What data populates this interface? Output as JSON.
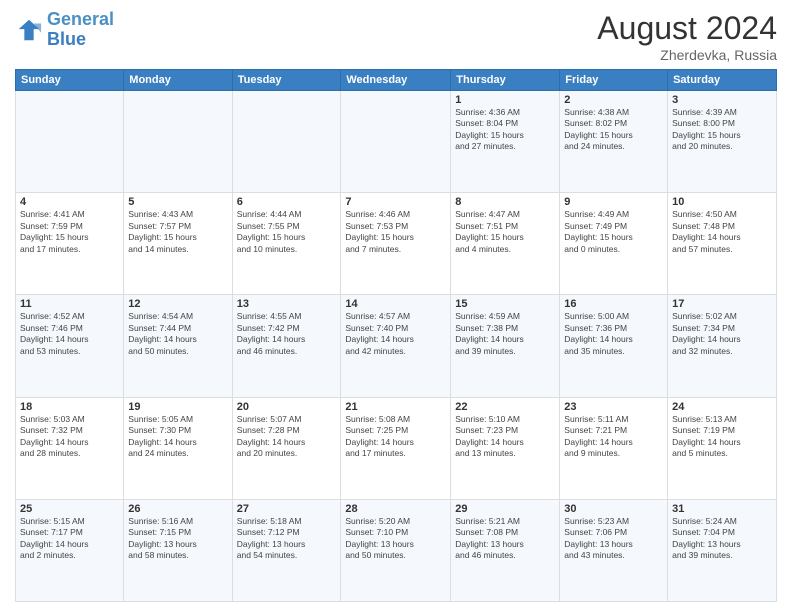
{
  "logo": {
    "line1": "General",
    "line2": "Blue"
  },
  "header": {
    "month_year": "August 2024",
    "location": "Zherdevka, Russia"
  },
  "weekdays": [
    "Sunday",
    "Monday",
    "Tuesday",
    "Wednesday",
    "Thursday",
    "Friday",
    "Saturday"
  ],
  "weeks": [
    [
      {
        "day": "",
        "info": ""
      },
      {
        "day": "",
        "info": ""
      },
      {
        "day": "",
        "info": ""
      },
      {
        "day": "",
        "info": ""
      },
      {
        "day": "1",
        "info": "Sunrise: 4:36 AM\nSunset: 8:04 PM\nDaylight: 15 hours\nand 27 minutes."
      },
      {
        "day": "2",
        "info": "Sunrise: 4:38 AM\nSunset: 8:02 PM\nDaylight: 15 hours\nand 24 minutes."
      },
      {
        "day": "3",
        "info": "Sunrise: 4:39 AM\nSunset: 8:00 PM\nDaylight: 15 hours\nand 20 minutes."
      }
    ],
    [
      {
        "day": "4",
        "info": "Sunrise: 4:41 AM\nSunset: 7:59 PM\nDaylight: 15 hours\nand 17 minutes."
      },
      {
        "day": "5",
        "info": "Sunrise: 4:43 AM\nSunset: 7:57 PM\nDaylight: 15 hours\nand 14 minutes."
      },
      {
        "day": "6",
        "info": "Sunrise: 4:44 AM\nSunset: 7:55 PM\nDaylight: 15 hours\nand 10 minutes."
      },
      {
        "day": "7",
        "info": "Sunrise: 4:46 AM\nSunset: 7:53 PM\nDaylight: 15 hours\nand 7 minutes."
      },
      {
        "day": "8",
        "info": "Sunrise: 4:47 AM\nSunset: 7:51 PM\nDaylight: 15 hours\nand 4 minutes."
      },
      {
        "day": "9",
        "info": "Sunrise: 4:49 AM\nSunset: 7:49 PM\nDaylight: 15 hours\nand 0 minutes."
      },
      {
        "day": "10",
        "info": "Sunrise: 4:50 AM\nSunset: 7:48 PM\nDaylight: 14 hours\nand 57 minutes."
      }
    ],
    [
      {
        "day": "11",
        "info": "Sunrise: 4:52 AM\nSunset: 7:46 PM\nDaylight: 14 hours\nand 53 minutes."
      },
      {
        "day": "12",
        "info": "Sunrise: 4:54 AM\nSunset: 7:44 PM\nDaylight: 14 hours\nand 50 minutes."
      },
      {
        "day": "13",
        "info": "Sunrise: 4:55 AM\nSunset: 7:42 PM\nDaylight: 14 hours\nand 46 minutes."
      },
      {
        "day": "14",
        "info": "Sunrise: 4:57 AM\nSunset: 7:40 PM\nDaylight: 14 hours\nand 42 minutes."
      },
      {
        "day": "15",
        "info": "Sunrise: 4:59 AM\nSunset: 7:38 PM\nDaylight: 14 hours\nand 39 minutes."
      },
      {
        "day": "16",
        "info": "Sunrise: 5:00 AM\nSunset: 7:36 PM\nDaylight: 14 hours\nand 35 minutes."
      },
      {
        "day": "17",
        "info": "Sunrise: 5:02 AM\nSunset: 7:34 PM\nDaylight: 14 hours\nand 32 minutes."
      }
    ],
    [
      {
        "day": "18",
        "info": "Sunrise: 5:03 AM\nSunset: 7:32 PM\nDaylight: 14 hours\nand 28 minutes."
      },
      {
        "day": "19",
        "info": "Sunrise: 5:05 AM\nSunset: 7:30 PM\nDaylight: 14 hours\nand 24 minutes."
      },
      {
        "day": "20",
        "info": "Sunrise: 5:07 AM\nSunset: 7:28 PM\nDaylight: 14 hours\nand 20 minutes."
      },
      {
        "day": "21",
        "info": "Sunrise: 5:08 AM\nSunset: 7:25 PM\nDaylight: 14 hours\nand 17 minutes."
      },
      {
        "day": "22",
        "info": "Sunrise: 5:10 AM\nSunset: 7:23 PM\nDaylight: 14 hours\nand 13 minutes."
      },
      {
        "day": "23",
        "info": "Sunrise: 5:11 AM\nSunset: 7:21 PM\nDaylight: 14 hours\nand 9 minutes."
      },
      {
        "day": "24",
        "info": "Sunrise: 5:13 AM\nSunset: 7:19 PM\nDaylight: 14 hours\nand 5 minutes."
      }
    ],
    [
      {
        "day": "25",
        "info": "Sunrise: 5:15 AM\nSunset: 7:17 PM\nDaylight: 14 hours\nand 2 minutes."
      },
      {
        "day": "26",
        "info": "Sunrise: 5:16 AM\nSunset: 7:15 PM\nDaylight: 13 hours\nand 58 minutes."
      },
      {
        "day": "27",
        "info": "Sunrise: 5:18 AM\nSunset: 7:12 PM\nDaylight: 13 hours\nand 54 minutes."
      },
      {
        "day": "28",
        "info": "Sunrise: 5:20 AM\nSunset: 7:10 PM\nDaylight: 13 hours\nand 50 minutes."
      },
      {
        "day": "29",
        "info": "Sunrise: 5:21 AM\nSunset: 7:08 PM\nDaylight: 13 hours\nand 46 minutes."
      },
      {
        "day": "30",
        "info": "Sunrise: 5:23 AM\nSunset: 7:06 PM\nDaylight: 13 hours\nand 43 minutes."
      },
      {
        "day": "31",
        "info": "Sunrise: 5:24 AM\nSunset: 7:04 PM\nDaylight: 13 hours\nand 39 minutes."
      }
    ]
  ]
}
